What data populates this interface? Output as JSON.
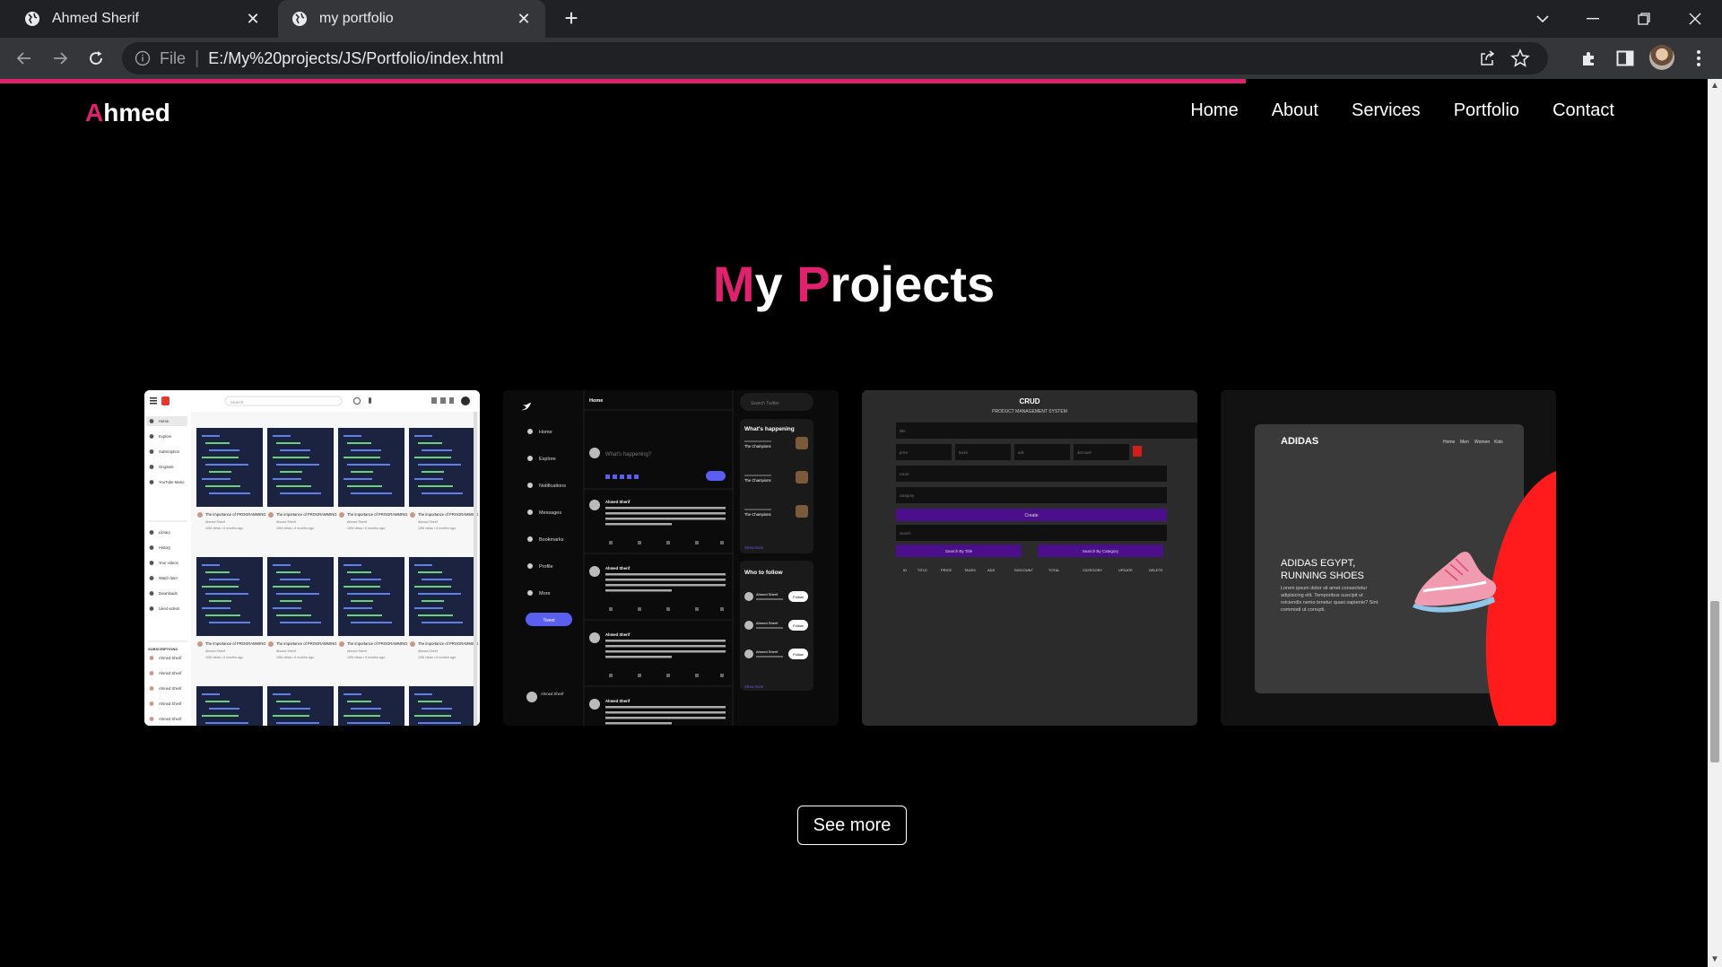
{
  "browser": {
    "tabs": [
      {
        "title": "Ahmed Sherif",
        "active": false
      },
      {
        "title": "my portfolio",
        "active": true
      }
    ],
    "address": {
      "scheme": "File",
      "url": "E:/My%20projects/JS/Portfolio/index.html"
    }
  },
  "page": {
    "brand": {
      "accent": "A",
      "rest": "hmed"
    },
    "nav": [
      "Home",
      "About",
      "Services",
      "Portfolio",
      "Contact"
    ],
    "section_title": {
      "word1_accent": "M",
      "word1_rest": "y",
      "word2_accent": "P",
      "word2_rest": "rojects"
    },
    "see_more": "See more",
    "projects": {
      "youtube_clone": {
        "video_caption": "The importance of PROGRAMMING",
        "channel": "Ahmed Sherif",
        "meta": "10M views • 6 months ago",
        "menu": [
          "Home",
          "Explore",
          "Subscription",
          "Originals",
          "YouTube Music",
          "Library",
          "History",
          "Your videos",
          "Watch later",
          "Downloads",
          "Liked videos"
        ],
        "subscriptions_label": "SUBSCRIPTIONS",
        "search_placeholder": "Search"
      },
      "twitter_clone": {
        "menu": [
          "Home",
          "Explore",
          "Notifications",
          "Messages",
          "Bookmarks",
          "Profile",
          "More"
        ],
        "tweet_button": "Tweet",
        "header": "Home",
        "compose_placeholder": "What's happening?",
        "search_placeholder": "Search Twitter",
        "trends_title": "What's happening",
        "trend_label": "The Champions",
        "show_more": "Show more",
        "follow_title": "Who to follow",
        "follow_button": "Follow",
        "user_name": "Ahmed Sherif"
      },
      "crud_app": {
        "title": "CRUD",
        "subtitle": "PRODUCT MANAGEMENT SYSTEM",
        "create_button": "Create",
        "search_title_button": "Search By Title",
        "search_category_button": "Search By Category",
        "columns": [
          "ID",
          "TITLE",
          "PRICE",
          "TAXES",
          "ADS",
          "DISCOUNT",
          "TOTAL",
          "CATEGORY",
          "UPDATE",
          "DELETE"
        ],
        "input_placeholders": [
          "title",
          "price",
          "taxes",
          "ads",
          "discount",
          "count",
          "category",
          "search"
        ]
      },
      "adidas_landing": {
        "logo": "ADIDAS",
        "nav": [
          "Home",
          "Men",
          "Women",
          "Kids"
        ],
        "headline_line1": "ADIDAS EGYPT,",
        "headline_line2": "RUNNING SHOES",
        "body": "Lorem ipsum dolor sit amet consectetur adipisicing elit. Temporibus suscipit ut reiciendis nemo tenetur quasi sapiente? Sint commodi ut corrupti."
      }
    }
  },
  "colors": {
    "accent": "#e0226e",
    "background": "#000000",
    "twitter_blue": "#5b5fef",
    "crud_purple": "#4b0f8c",
    "adidas_red": "#ff1b1b"
  }
}
